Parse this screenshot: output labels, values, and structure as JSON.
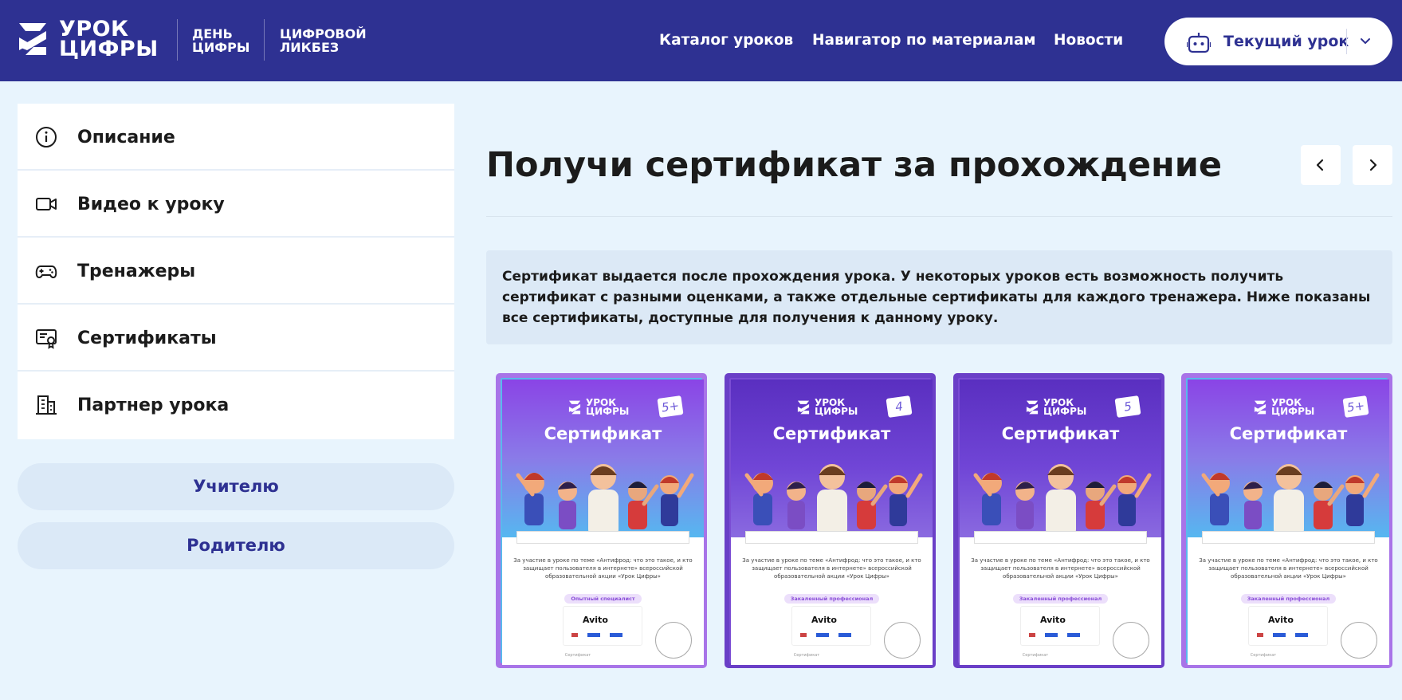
{
  "header": {
    "logo_line1": "УРОК",
    "logo_line2": "ЦИФРЫ",
    "sub1_line1": "ДЕНЬ",
    "sub1_line2": "ЦИФРЫ",
    "sub2_line1": "ЦИФРОВОЙ",
    "sub2_line2": "ЛИКБЕЗ",
    "nav": [
      "Каталог уроков",
      "Навигатор по материалам",
      "Новости"
    ],
    "current_lesson": "Текущий урок",
    "brand_color": "#2e3192"
  },
  "sidebar": {
    "items": [
      {
        "label": "Описание",
        "icon": "info-icon"
      },
      {
        "label": "Видео к уроку",
        "icon": "video-camera-icon"
      },
      {
        "label": "Тренажеры",
        "icon": "gamepad-icon"
      },
      {
        "label": "Сертификаты",
        "icon": "certificate-icon"
      },
      {
        "label": "Партнер урока",
        "icon": "building-icon"
      }
    ],
    "buttons": [
      "Учителю",
      "Родителю"
    ]
  },
  "main": {
    "title": "Получи сертификат за прохождение",
    "info": "Сертификат выдается после прохождения урока. У некоторых уроков есть возможность получить сертификат с разными оценками, а также отдельные сертификаты для каждого тренажера. Ниже показаны все сертификаты, доступные для получения к данному уроку."
  },
  "certificates": [
    {
      "logo_line1": "УРОК",
      "logo_line2": "ЦИФРЫ",
      "grade": "5+",
      "word": "Сертификат",
      "text": "За участие в уроке по теме «Антифрод: что это такое, и кто защищает пользователя в интернете» всероссийской образовательной акции «Урок Цифры»",
      "badge": "Опытный специалист",
      "partner": "Avito",
      "footer": "Сертификат",
      "style": "light"
    },
    {
      "logo_line1": "УРОК",
      "logo_line2": "ЦИФРЫ",
      "grade": "4",
      "word": "Сертификат",
      "text": "За участие в уроке по теме «Антифрод: что это такое, и кто защищает пользователя в интернете» всероссийской образовательной акции «Урок Цифры»",
      "badge": "Закаленный профессионал",
      "partner": "Avito",
      "footer": "Сертификат",
      "style": "dark"
    },
    {
      "logo_line1": "УРОК",
      "logo_line2": "ЦИФРЫ",
      "grade": "5",
      "word": "Сертификат",
      "text": "За участие в уроке по теме «Антифрод: что это такое, и кто защищает пользователя в интернете» всероссийской образовательной акции «Урок Цифры»",
      "badge": "Закаленный профессионал",
      "partner": "Avito",
      "footer": "Сертификат",
      "style": "dark"
    },
    {
      "logo_line1": "УРОК",
      "logo_line2": "ЦИФРЫ",
      "grade": "5+",
      "word": "Сертификат",
      "text": "За участие в уроке по теме «Антифрод: что это такое, и кто защищает пользователя в интернете» всероссийской образовательной акции «Урок Цифры»",
      "badge": "Закаленный профессионал",
      "partner": "Avito",
      "footer": "Сертификат",
      "style": "light"
    }
  ]
}
